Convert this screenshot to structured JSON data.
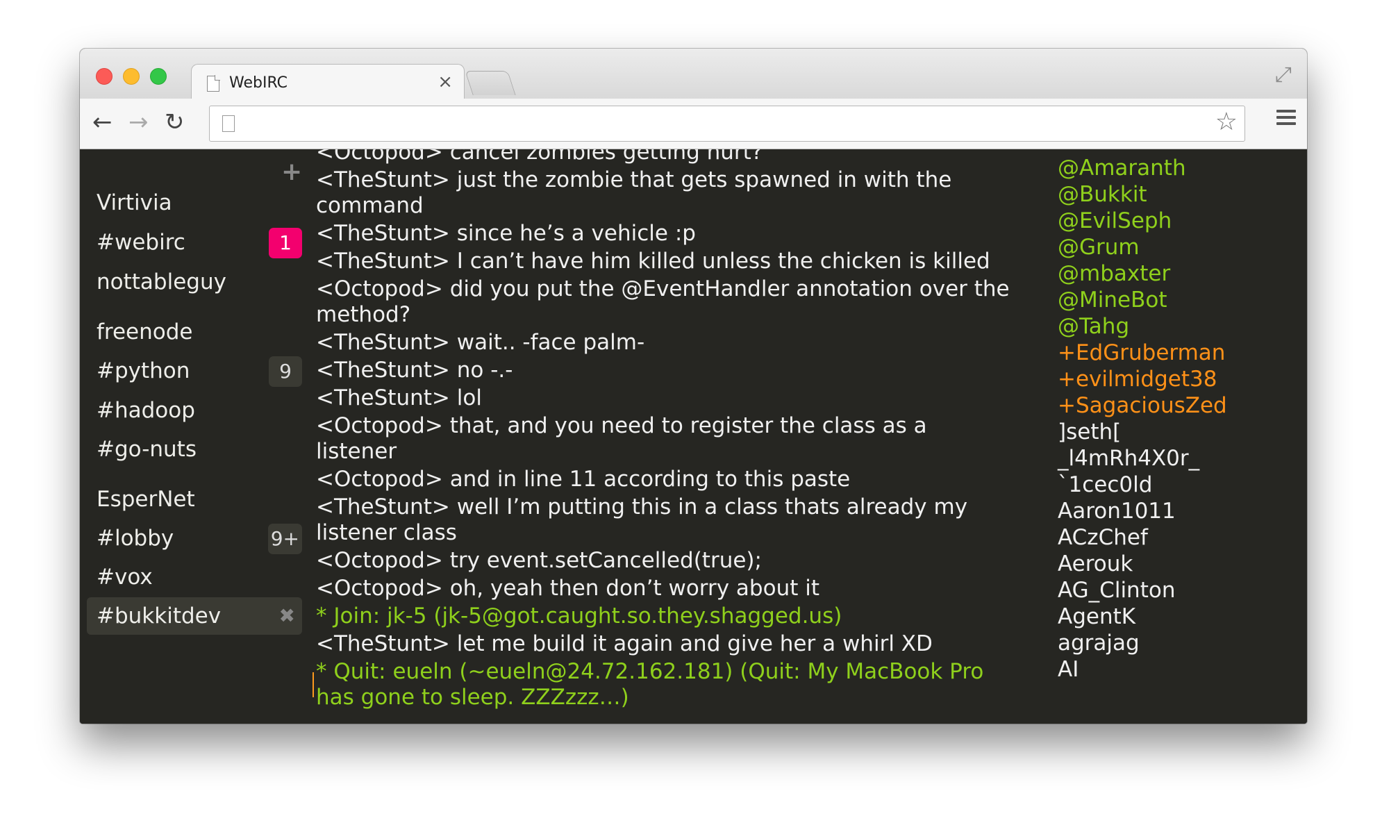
{
  "browser": {
    "tab_title": "WebIRC",
    "tab_close": "×",
    "url": ""
  },
  "sidebar": {
    "add": "+",
    "networks": [
      {
        "name": "Virtivia",
        "channels": [
          {
            "label": "#webirc",
            "badge": "1",
            "badge_style": "pink"
          },
          {
            "label": "nottableguy"
          }
        ]
      },
      {
        "name": "freenode",
        "channels": [
          {
            "label": "#python",
            "badge": "9",
            "badge_style": "grey"
          },
          {
            "label": "#hadoop"
          },
          {
            "label": "#go-nuts"
          }
        ]
      },
      {
        "name": "EsperNet",
        "channels": [
          {
            "label": "#lobby",
            "badge": "9+",
            "badge_style": "grey"
          },
          {
            "label": "#vox"
          },
          {
            "label": "#bukkitdev",
            "active": true,
            "close": "✖"
          }
        ]
      }
    ]
  },
  "messages": [
    {
      "text": "<Octopod> cancel zombies getting hurt?",
      "type": "normal"
    },
    {
      "text": "<TheStunt> just the zombie that gets spawned in with the command",
      "type": "normal"
    },
    {
      "text": "<TheStunt> since he’s a vehicle :p",
      "type": "normal"
    },
    {
      "text": "<TheStunt> I can’t have him killed unless the chicken is killed",
      "type": "normal"
    },
    {
      "text": "<Octopod> did you put the @EventHandler annotation over the method?",
      "type": "normal"
    },
    {
      "text": "<TheStunt> wait.. -face palm-",
      "type": "normal"
    },
    {
      "text": "<TheStunt> no -.-",
      "type": "normal"
    },
    {
      "text": "<TheStunt> lol",
      "type": "normal"
    },
    {
      "text": "<Octopod> that, and you need to register the class as a listener",
      "type": "normal"
    },
    {
      "text": "<Octopod> and in line 11 according to this paste",
      "type": "normal"
    },
    {
      "text": "<TheStunt> well I’m putting this in a class thats already my listener class",
      "type": "normal"
    },
    {
      "text": "<Octopod> try event.setCancelled(true);",
      "type": "normal"
    },
    {
      "text": "<Octopod> oh, yeah then don’t worry about it",
      "type": "normal"
    },
    {
      "text": "* Join: jk-5 (jk-5@got.caught.so.they.shagged.us)",
      "type": "event"
    },
    {
      "text": "<TheStunt> let me build it again and give her a whirl XD",
      "type": "normal"
    },
    {
      "text": "* Quit: eueln (~eueln@24.72.162.181) (Quit: My MacBook Pro has gone to sleep. ZZZzzz…)",
      "type": "event"
    }
  ],
  "users": [
    {
      "name": "@Amaranth",
      "type": "op"
    },
    {
      "name": "@Bukkit",
      "type": "op"
    },
    {
      "name": "@EvilSeph",
      "type": "op"
    },
    {
      "name": "@Grum",
      "type": "op"
    },
    {
      "name": "@mbaxter",
      "type": "op"
    },
    {
      "name": "@MineBot",
      "type": "op"
    },
    {
      "name": "@Tahg",
      "type": "op"
    },
    {
      "name": "+EdGruberman",
      "type": "voice"
    },
    {
      "name": "+evilmidget38",
      "type": "voice"
    },
    {
      "name": "+SagaciousZed",
      "type": "voice"
    },
    {
      "name": "]seth[",
      "type": "normal"
    },
    {
      "name": "_l4mRh4X0r_",
      "type": "normal"
    },
    {
      "name": "`1cec0ld",
      "type": "normal"
    },
    {
      "name": "Aaron1011",
      "type": "normal"
    },
    {
      "name": "ACzChef",
      "type": "normal"
    },
    {
      "name": "Aerouk",
      "type": "normal"
    },
    {
      "name": "AG_Clinton",
      "type": "normal"
    },
    {
      "name": "AgentK",
      "type": "normal"
    },
    {
      "name": "agrajag",
      "type": "normal"
    },
    {
      "name": "AI",
      "type": "normal"
    }
  ],
  "colors": {
    "background": "#262622",
    "op": "#8fd01c",
    "voice": "#ff9118",
    "badge_pink": "#f3006e",
    "cursor": "#ff9a1e"
  }
}
